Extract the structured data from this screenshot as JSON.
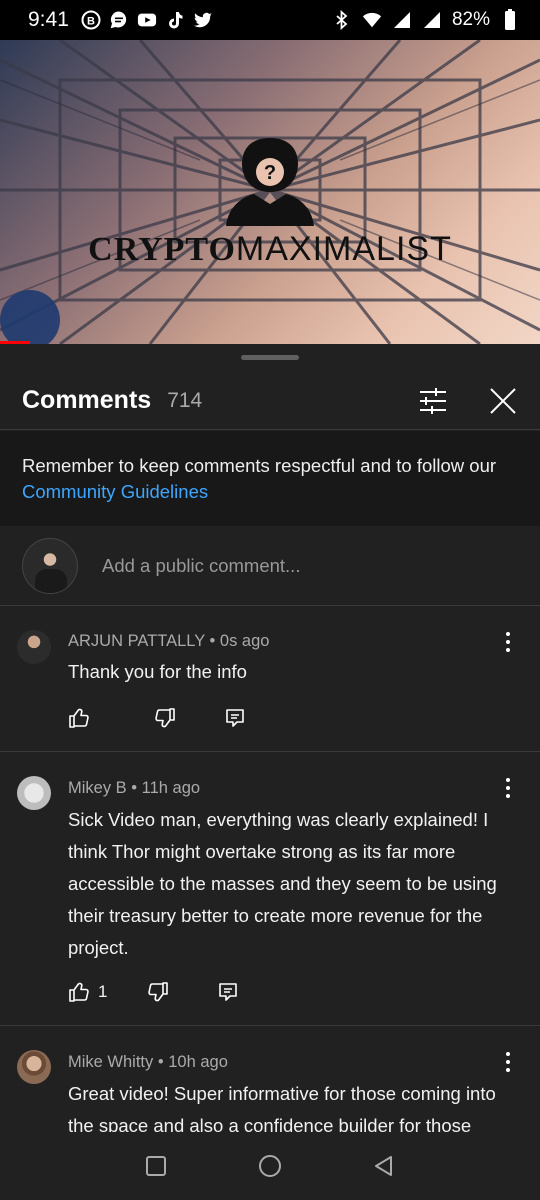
{
  "status_bar": {
    "time": "9:41",
    "battery": "82%",
    "left_icons": [
      "b-icon",
      "message-icon",
      "youtube-icon",
      "tiktok-icon",
      "twitter-icon"
    ],
    "right_icons": [
      "bluetooth-icon",
      "wifi-icon",
      "signal-icon",
      "signal-icon",
      "battery-icon"
    ]
  },
  "video": {
    "logo_bold": "CRYPTO",
    "logo_light": "MAXIMALIST",
    "progress": 0.055,
    "accent": "#ff0000"
  },
  "comments_sheet": {
    "title": "Comments",
    "count": "714",
    "guidelines_text": "Remember to keep comments respectful and to follow our",
    "guidelines_link": "Community Guidelines",
    "link_color": "#3ea6ff",
    "add_placeholder": "Add a public comment..."
  },
  "comments": [
    {
      "author": "ARJUN PATTALLY",
      "time": "0s ago",
      "text": "Thank you for the info",
      "likes": ""
    },
    {
      "author": "Mikey B",
      "time": "11h ago",
      "text": "Sick Video man, everything was clearly explained! I think Thor might overtake strong as its far more accessible to the masses and they seem to be using their treasury better to create more revenue for the project.",
      "likes": "1"
    },
    {
      "author": "Mike Whitty",
      "time": "10h ago",
      "text": "Great video! Super informative for those coming into the space and also a confidence builder for those",
      "likes": ""
    }
  ],
  "separator": "•"
}
